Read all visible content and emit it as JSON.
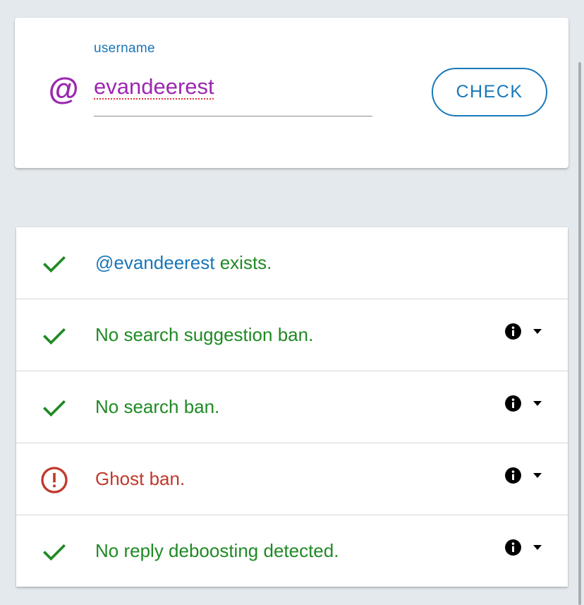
{
  "search": {
    "label": "username",
    "value": "evandeerest",
    "prefix_icon": "at-sign-icon",
    "button_label": "CHECK"
  },
  "results": [
    {
      "status": "ok",
      "icon": "check-icon",
      "handle": "@evandeerest",
      "text": " exists.",
      "has_info": false
    },
    {
      "status": "ok",
      "icon": "check-icon",
      "text": "No search suggestion ban.",
      "has_info": true
    },
    {
      "status": "ok",
      "icon": "check-icon",
      "text": "No search ban.",
      "has_info": true
    },
    {
      "status": "warning",
      "icon": "alert-circle-icon",
      "text": "Ghost ban.",
      "has_info": true
    },
    {
      "status": "ok",
      "icon": "check-icon",
      "text": "No reply deboosting detected.",
      "has_info": true
    }
  ],
  "colors": {
    "ok": "#1f8a24",
    "warning": "#c0392b",
    "accent": "#1976b8",
    "input_text": "#9c27b0",
    "background": "#e4e9ed"
  }
}
